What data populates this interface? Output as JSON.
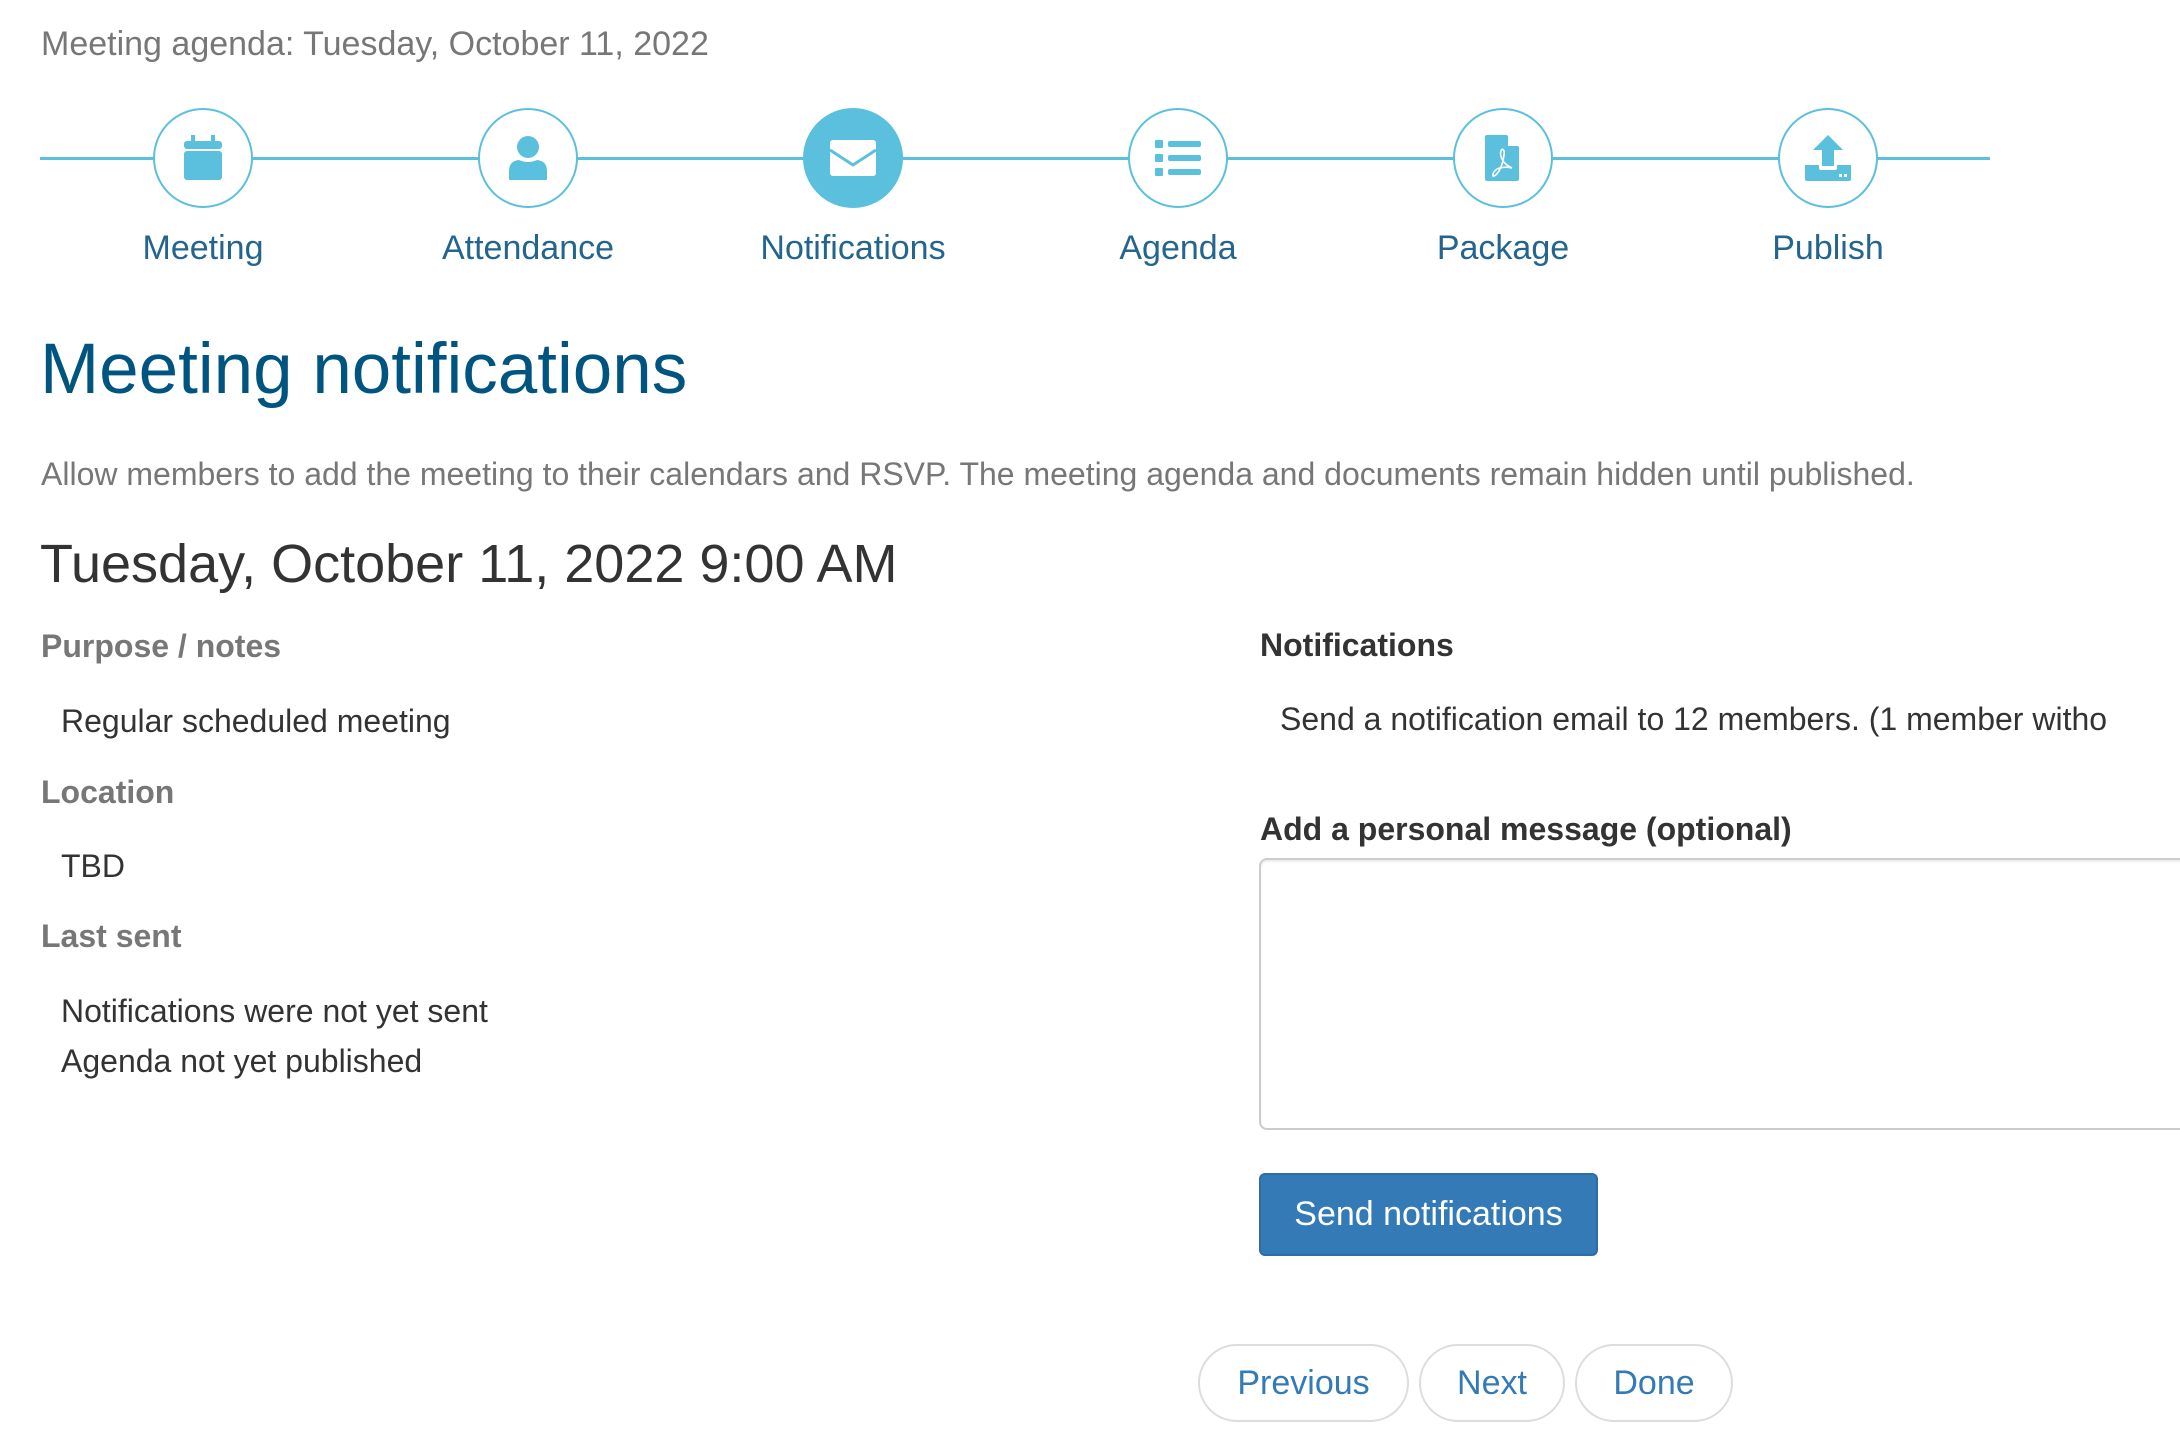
{
  "header": {
    "context_title": "Meeting agenda: Tuesday, October 11, 2022"
  },
  "stepper": {
    "active_index": 2,
    "accent_color": "#5bc0de",
    "steps": [
      {
        "label": "Meeting",
        "icon": "calendar-icon"
      },
      {
        "label": "Attendance",
        "icon": "user-icon"
      },
      {
        "label": "Notifications",
        "icon": "envelope-icon"
      },
      {
        "label": "Agenda",
        "icon": "list-icon"
      },
      {
        "label": "Package",
        "icon": "pdf-file-icon"
      },
      {
        "label": "Publish",
        "icon": "upload-icon"
      }
    ]
  },
  "page": {
    "title": "Meeting notifications",
    "description": "Allow members to add the meeting to their calendars and RSVP. The meeting agenda and documents remain hidden until published.",
    "datetime": "Tuesday, October 11, 2022 9:00 AM"
  },
  "details": {
    "purpose_label": "Purpose / notes",
    "purpose_value": "Regular scheduled meeting",
    "location_label": "Location",
    "location_value": "TBD",
    "last_sent_label": "Last sent",
    "last_sent_lines": [
      "Notifications were not yet sent",
      "Agenda not yet published"
    ]
  },
  "notifications": {
    "heading": "Notifications",
    "summary": "Send a notification email to 12 members. (1 member witho",
    "message_label": "Add a personal message (optional)",
    "message_value": "",
    "send_label": "Send notifications",
    "send_color": "#337ab7"
  },
  "pager": {
    "previous_label": "Previous",
    "next_label": "Next",
    "done_label": "Done"
  }
}
